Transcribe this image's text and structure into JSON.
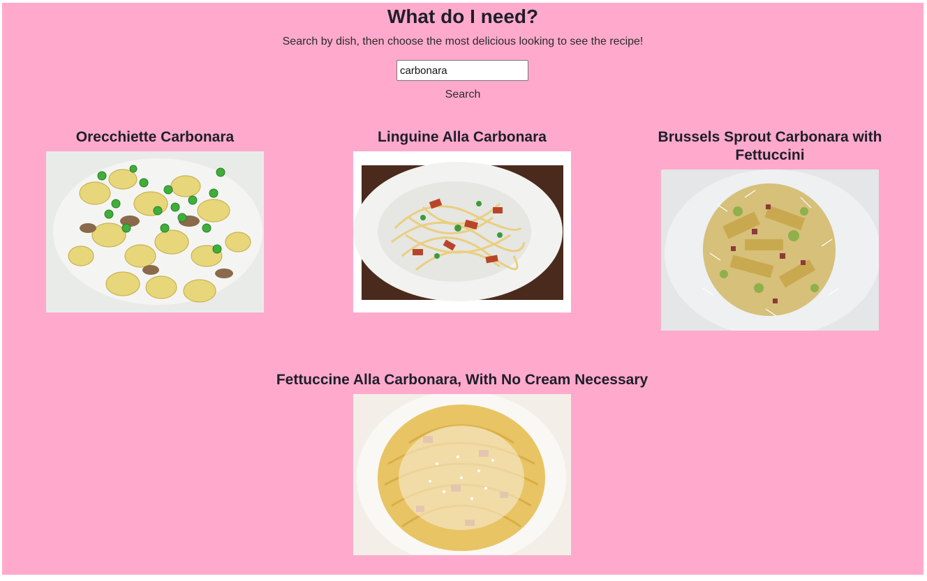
{
  "header": {
    "title": "What do I need?",
    "subtitle": "Search by dish, then choose the most delicious looking to see the recipe!"
  },
  "search": {
    "value": "carbonara",
    "button_label": "Search"
  },
  "results": [
    {
      "title": "Orecchiette Carbonara",
      "image_icon": "orecchiette-pasta-with-peas-photo"
    },
    {
      "title": "Linguine Alla Carbonara",
      "image_icon": "linguine-with-bacon-photo"
    },
    {
      "title": "Brussels Sprout Carbonara with Fettuccini",
      "image_icon": "pappardelle-with-brussels-sprouts-photo"
    },
    {
      "title": "Fettuccine Alla Carbonara, With No Cream Necessary",
      "image_icon": "fettuccine-with-parmesan-photo"
    }
  ],
  "colors": {
    "page_background": "#ffaacc",
    "text": "#1e1e2a"
  }
}
